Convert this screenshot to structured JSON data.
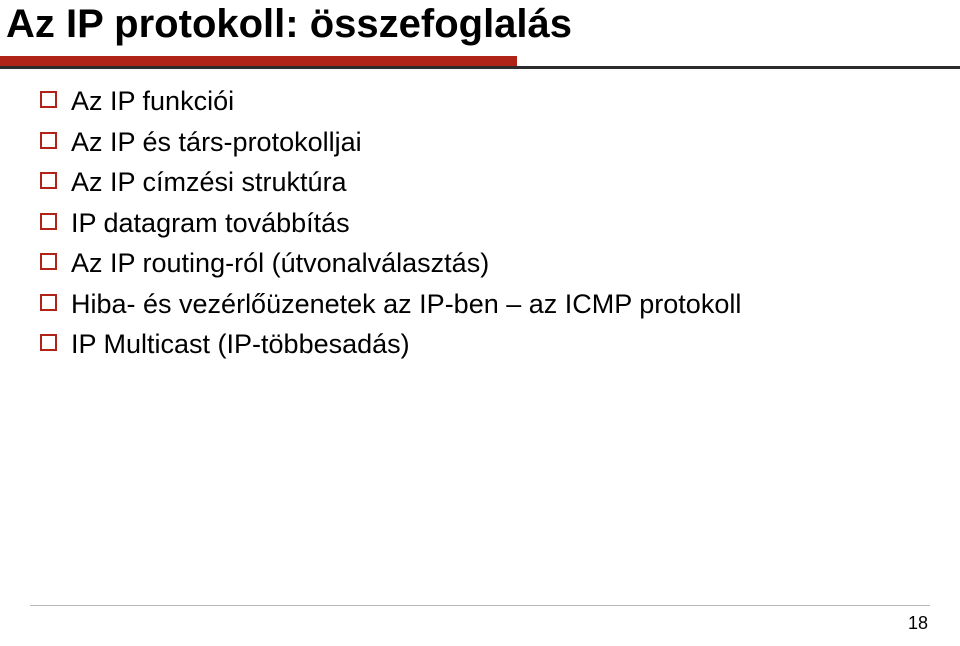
{
  "title": "Az IP protokoll: összefoglalás",
  "bullets": [
    {
      "text": "Az IP funkciói"
    },
    {
      "text": "Az IP és társ-protokolljai"
    },
    {
      "text": "Az IP címzési struktúra"
    },
    {
      "text": "IP datagram továbbítás"
    },
    {
      "text": "Az IP routing-ról (útvonalválasztás)"
    },
    {
      "text": "Hiba- és vezérlőüzenetek az IP-ben – az ICMP protokoll"
    },
    {
      "text": "IP Multicast (IP-többesadás)"
    }
  ],
  "page_number": "18"
}
